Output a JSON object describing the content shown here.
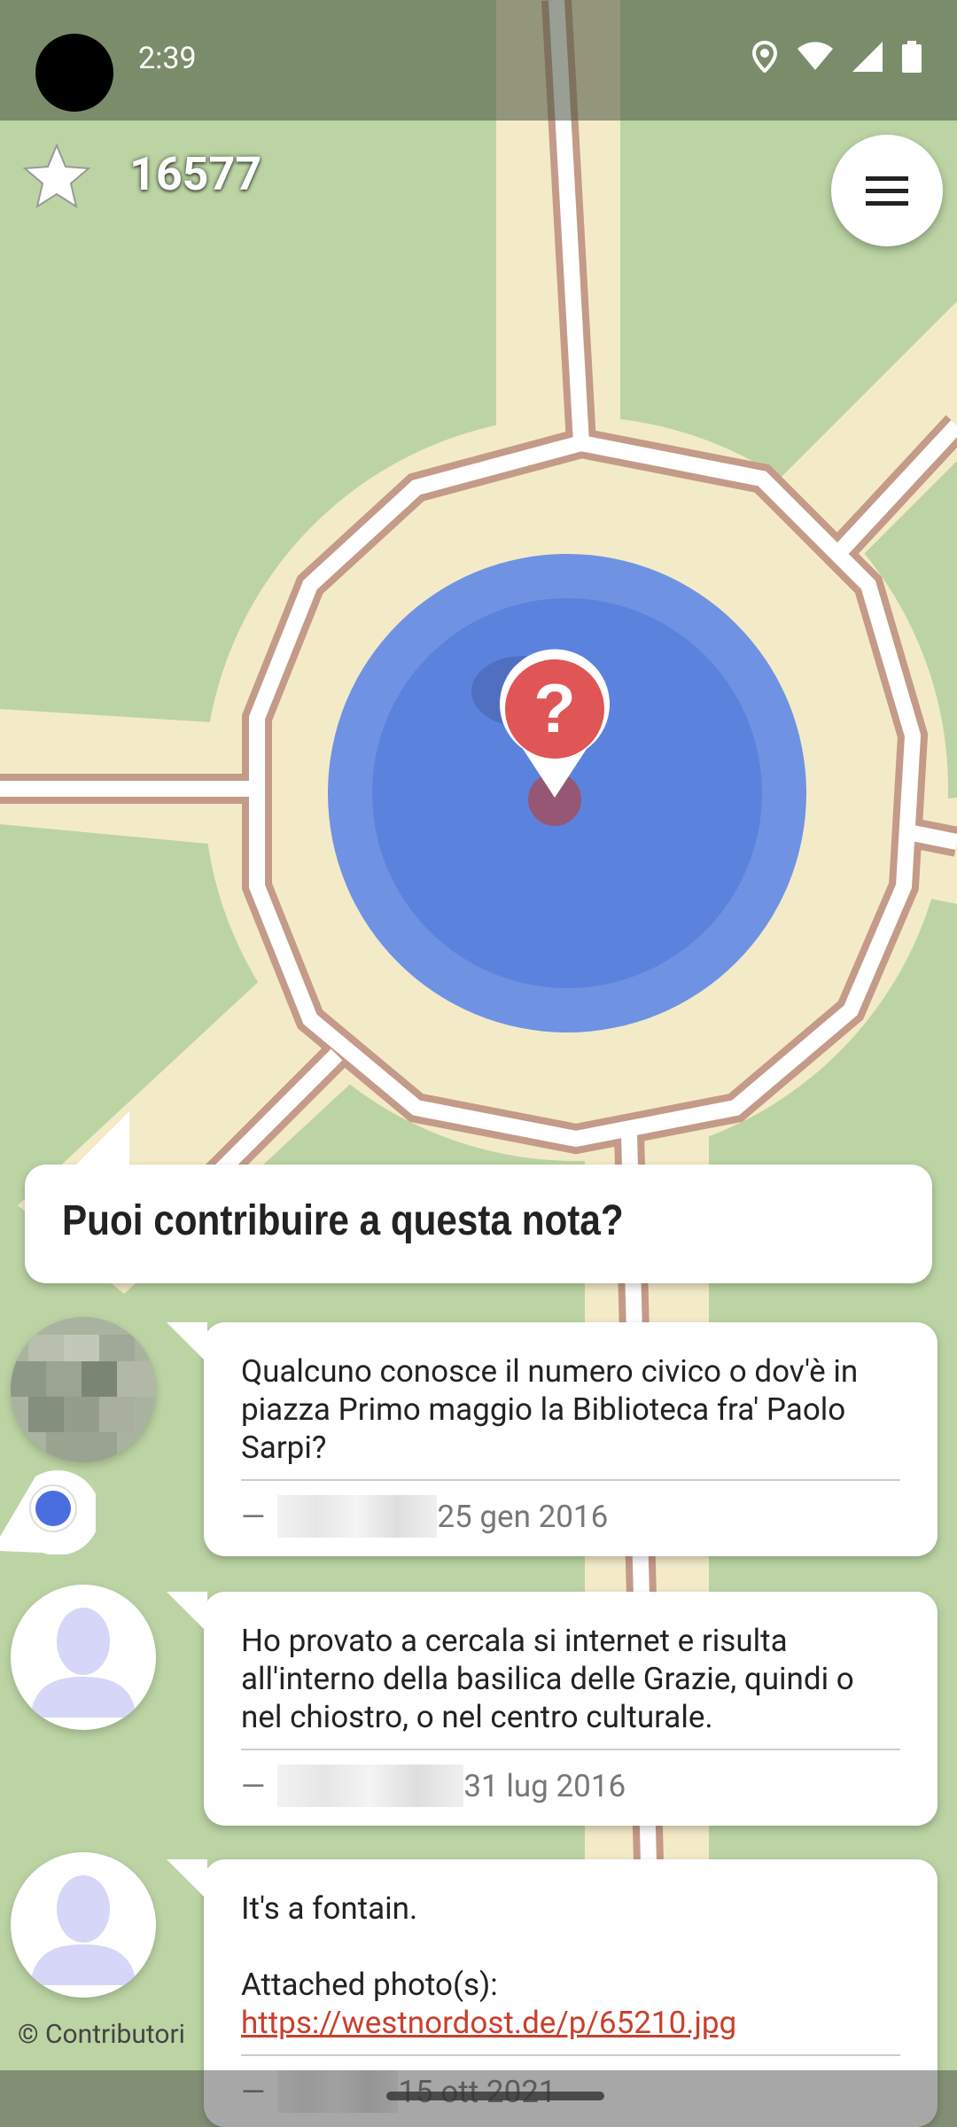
{
  "status_bar": {
    "time": "2:39",
    "icons": [
      "location-icon",
      "wifi-icon",
      "signal-icon",
      "battery-icon"
    ]
  },
  "top_bar": {
    "star_icon": "star-icon",
    "score": "16577",
    "menu_icon": "hamburger-menu-icon"
  },
  "map": {
    "marker_icon": "question-marker-icon",
    "copyright": "© Contributori"
  },
  "note": {
    "question": "Puoi contribuire a questa nota?",
    "comments": [
      {
        "text": "Qualcuno conosce il numero civico o dov'è in piazza Primo maggio la Biblioteca fra' Paolo Sarpi?",
        "dash": "—",
        "date": "25 gen 2016",
        "avatar": "pixelated-avatar"
      },
      {
        "text": "Ho provato a cercala si internet e risulta all'interno della basilica delle Grazie, quindi o nel chiostro, o nel centro culturale.",
        "dash": "—",
        "date": "31 lug 2016",
        "avatar": "default-user-avatar"
      },
      {
        "text_line1": "It's a fontain.",
        "text_line2": "Attached photo(s):",
        "link": "https://westnordost.de/p/65210.jpg",
        "dash": "—",
        "date": "15 ott 2021",
        "avatar": "default-user-avatar"
      }
    ]
  },
  "colors": {
    "map_green": "#bcd4a4",
    "road_cream": "#f3ebc8",
    "road_outline": "#c49a88",
    "accuracy_blue": "#5b83de",
    "marker_red": "#e05555",
    "link_red": "#c8402c"
  }
}
